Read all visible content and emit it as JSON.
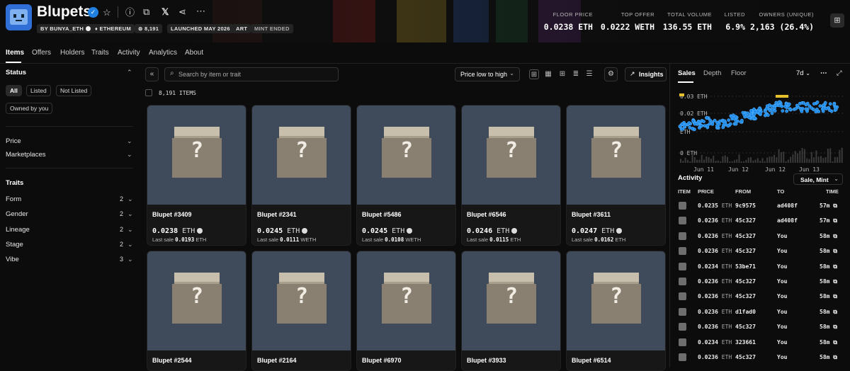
{
  "collection": {
    "name": "Blupets",
    "tags": [
      "BY BUNYA_ETH",
      "ETHEREUM",
      "8,191",
      "LAUNCHED MAY 2026",
      "ART",
      "MINT ENDED"
    ],
    "stats": [
      {
        "label": "FLOOR PRICE",
        "value": "0.0238 ETH"
      },
      {
        "label": "TOP OFFER",
        "value": "0.0222 WETH"
      },
      {
        "label": "TOTAL VOLUME",
        "value": "136.55 ETH"
      },
      {
        "label": "LISTED",
        "value": "6.9%"
      },
      {
        "label": "OWNERS (UNIQUE)",
        "value": "2,163 (26.4%)"
      }
    ]
  },
  "nav": {
    "tabs": [
      "Items",
      "Offers",
      "Holders",
      "Traits",
      "Activity",
      "Analytics",
      "About"
    ],
    "active": "Items"
  },
  "sidebar": {
    "status_title": "Status",
    "status_chips": [
      "All",
      "Listed",
      "Not Listed",
      "Owned by you"
    ],
    "filters": [
      "Price",
      "Marketplaces"
    ],
    "traits_title": "Traits",
    "traits": [
      {
        "name": "Form",
        "count": "2"
      },
      {
        "name": "Gender",
        "count": "2"
      },
      {
        "name": "Lineage",
        "count": "2"
      },
      {
        "name": "Stage",
        "count": "2"
      },
      {
        "name": "Vibe",
        "count": "3"
      }
    ]
  },
  "toolbar": {
    "search_placeholder": "Search by item or trait",
    "sort": "Price low to high",
    "insights": "Insights",
    "item_count": "8,191 ITEMS"
  },
  "items": [
    {
      "name": "Blupet #3409",
      "price": "0.0238",
      "unit": "ETH",
      "last_price": "0.0193",
      "last_unit": "ETH"
    },
    {
      "name": "Blupet #2341",
      "price": "0.0245",
      "unit": "ETH",
      "last_price": "0.0111",
      "last_unit": "WETH"
    },
    {
      "name": "Blupet #5486",
      "price": "0.0245",
      "unit": "ETH",
      "last_price": "0.0108",
      "last_unit": "WETH"
    },
    {
      "name": "Blupet #6546",
      "price": "0.0246",
      "unit": "ETH",
      "last_price": "0.0115",
      "last_unit": "ETH"
    },
    {
      "name": "Blupet #3611",
      "price": "0.0247",
      "unit": "ETH",
      "last_price": "0.0162",
      "last_unit": "ETH"
    },
    {
      "name": "Blupet #2544"
    },
    {
      "name": "Blupet #2164"
    },
    {
      "name": "Blupet #6970"
    },
    {
      "name": "Blupet #3933"
    },
    {
      "name": "Blupet #6514"
    }
  ],
  "last_sale_label": "Last sale",
  "panel": {
    "tabs": [
      "Sales",
      "Depth",
      "Floor"
    ],
    "active": "Sales",
    "range": "7d",
    "y_ticks": [
      "0.03 ETH",
      "0.02 ETH",
      "ETH",
      "0 ETH"
    ],
    "x_ticks": [
      "Jun 11",
      "Jun 12",
      "Jun 12",
      "Jun 13"
    ],
    "activity_title": "Activity",
    "activity_filter": "Sale, Mint",
    "columns": [
      "ITEM",
      "PRICE",
      "FROM",
      "TO",
      "TIME"
    ],
    "rows": [
      {
        "price": "0.0235",
        "unit": "ETH",
        "from": "9c9575",
        "to": "ad408f",
        "time": "57m"
      },
      {
        "price": "0.0236",
        "unit": "ETH",
        "from": "45c327",
        "to": "ad408f",
        "time": "57m"
      },
      {
        "price": "0.0236",
        "unit": "ETH",
        "from": "45c327",
        "to": "You",
        "time": "58m"
      },
      {
        "price": "0.0236",
        "unit": "ETH",
        "from": "45c327",
        "to": "You",
        "time": "58m"
      },
      {
        "price": "0.0234",
        "unit": "ETH",
        "from": "53be71",
        "to": "You",
        "time": "58m"
      },
      {
        "price": "0.0236",
        "unit": "ETH",
        "from": "45c327",
        "to": "You",
        "time": "58m"
      },
      {
        "price": "0.0236",
        "unit": "ETH",
        "from": "45c327",
        "to": "You",
        "time": "58m"
      },
      {
        "price": "0.0236",
        "unit": "ETH",
        "from": "d1fad0",
        "to": "You",
        "time": "58m"
      },
      {
        "price": "0.0236",
        "unit": "ETH",
        "from": "45c327",
        "to": "You",
        "time": "58m"
      },
      {
        "price": "0.0234",
        "unit": "ETH",
        "from": "323661",
        "to": "You",
        "time": "58m"
      },
      {
        "price": "0.0236",
        "unit": "ETH",
        "from": "45c327",
        "to": "You",
        "time": "58m"
      }
    ]
  },
  "colors": {
    "accent": "#2081e2",
    "card_bg": "#3f4a5a",
    "page_bg": "#0c0c0c"
  }
}
